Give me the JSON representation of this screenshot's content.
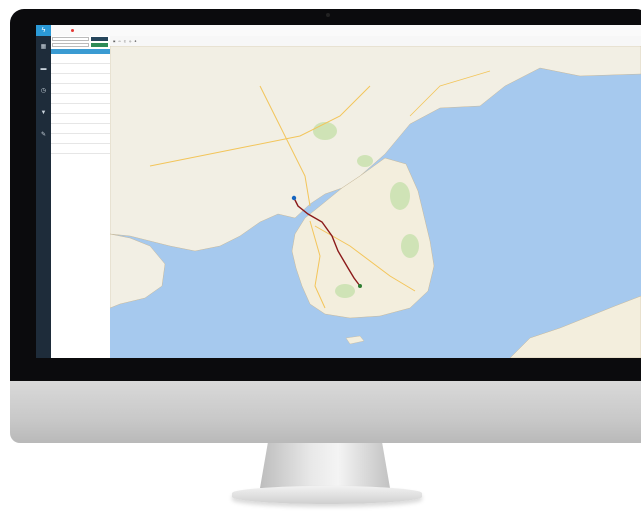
{
  "colors": {
    "nav_bg": "#1e2c3a",
    "accent": "#2b9ad7",
    "table_header": "#3a9bd2",
    "sea": "#a6c9ee",
    "land": "#f2efe4",
    "route": "#c62828"
  },
  "nav": {
    "logo_icon": "bolt-logo",
    "items": [
      {
        "icon": "grid-icon",
        "glyph": "▦"
      },
      {
        "icon": "truck-icon",
        "glyph": "▬"
      },
      {
        "icon": "clock-icon",
        "glyph": "◷"
      },
      {
        "icon": "filter-icon",
        "glyph": "▼"
      },
      {
        "icon": "wrench-icon",
        "glyph": "✎"
      }
    ]
  },
  "topbar": {
    "items": [
      "",
      "",
      ""
    ]
  },
  "panel": {
    "buttons": [
      "",
      ""
    ],
    "table": {
      "headers": [
        "",
        "",
        ""
      ],
      "rows": [
        [
          "",
          "",
          ""
        ],
        [
          "",
          "",
          ""
        ],
        [
          "",
          "",
          ""
        ],
        [
          "",
          "",
          ""
        ],
        [
          "",
          "",
          ""
        ],
        [
          "",
          "",
          ""
        ],
        [
          "",
          "",
          ""
        ],
        [
          "",
          "",
          ""
        ],
        [
          "",
          "",
          ""
        ],
        [
          "",
          "",
          ""
        ]
      ]
    }
  }
}
